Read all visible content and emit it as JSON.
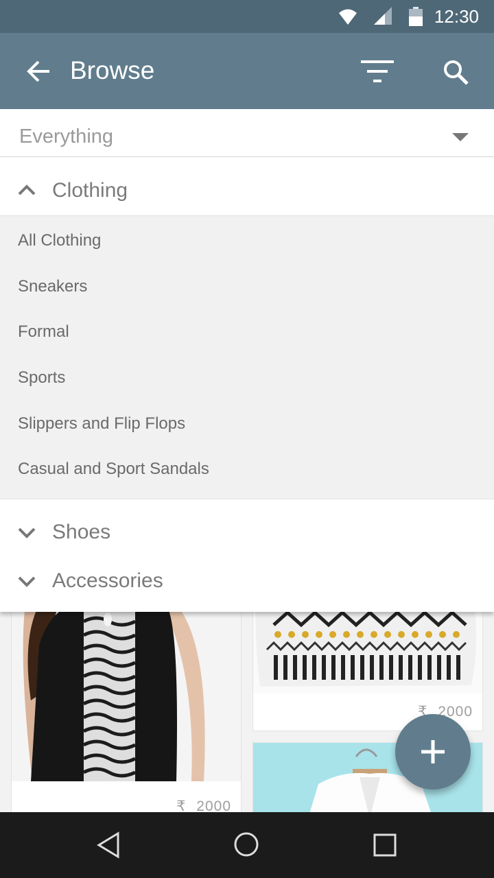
{
  "status_bar": {
    "time": "12:30",
    "icons": [
      "wifi-icon",
      "signal-icon",
      "battery-icon"
    ]
  },
  "app_bar": {
    "title": "Browse",
    "icons": [
      "back-arrow-icon",
      "filter-icon",
      "search-icon"
    ]
  },
  "dropdown": {
    "selected": "Everything"
  },
  "categories": {
    "expanded": {
      "label": "Clothing",
      "subitems": [
        "All Clothing",
        "Sneakers",
        "Formal",
        "Sports",
        "Slippers and Flip Flops",
        "Casual and Sport Sandals"
      ]
    },
    "collapsed": [
      "Shoes",
      "Accessories"
    ]
  },
  "products": [
    {
      "currency": "₹",
      "price": "2000"
    },
    {
      "currency": "₹",
      "price": "2000"
    }
  ],
  "colors": {
    "status_bar": "#4f6877",
    "app_bar": "#617d8d",
    "fab": "#617d8d"
  }
}
